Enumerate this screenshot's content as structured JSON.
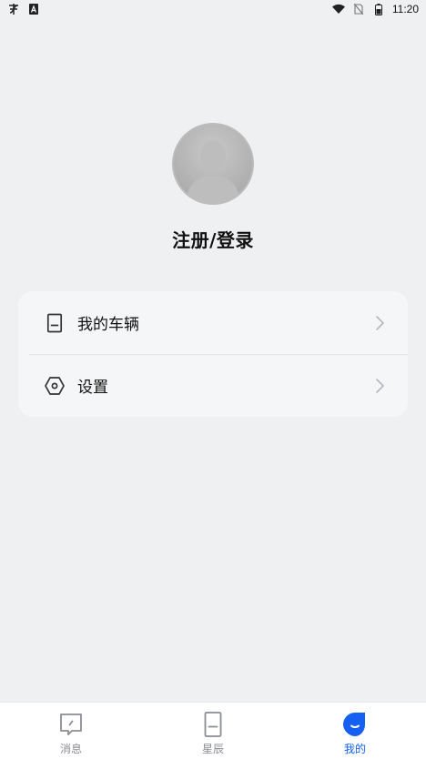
{
  "status_bar": {
    "time": "11:20",
    "left_icons": [
      "network-activity-icon",
      "keyboard-a-icon"
    ],
    "right_icons": [
      "wifi-icon",
      "no-sim-icon",
      "battery-icon"
    ]
  },
  "profile": {
    "title": "注册/登录",
    "avatar": "default-avatar-icon"
  },
  "menu": {
    "items": [
      {
        "label": "我的车辆",
        "icon": "car-icon"
      },
      {
        "label": "设置",
        "icon": "settings-hexagon-icon"
      }
    ]
  },
  "bottom_nav": {
    "tabs": [
      {
        "label": "消息",
        "icon": "message-icon",
        "active": false
      },
      {
        "label": "星辰",
        "icon": "car-icon",
        "active": false
      },
      {
        "label": "我的",
        "icon": "profile-icon",
        "active": true
      }
    ],
    "active_color": "#1560f2",
    "inactive_color": "#8a8d93"
  }
}
